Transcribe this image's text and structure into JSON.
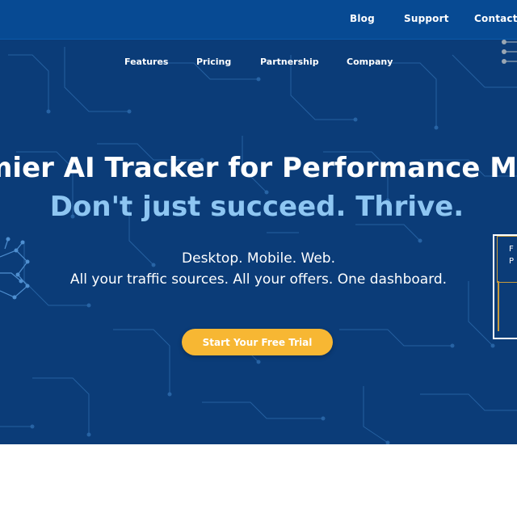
{
  "topbar": {
    "links": [
      "Blog",
      "Support",
      "Contact"
    ]
  },
  "nav": {
    "items": [
      "Features",
      "Pricing",
      "Partnership",
      "Company"
    ]
  },
  "hero": {
    "headline": "mier AI Tracker for Performance Ma",
    "tagline": "Don't just succeed. Thrive.",
    "subline1": "Desktop. Mobile. Web.",
    "subline2": "All your traffic sources. All your offers. One dashboard.",
    "cta_label": "Start Your Free Trial"
  },
  "badge": {
    "line1": "F",
    "line2": "P"
  },
  "colors": {
    "topbar": "#074a93",
    "hero_bg": "#0b3c78",
    "tagline": "#8ec6f2",
    "cta": "#f7b733",
    "circuit": "#2a67a8"
  }
}
